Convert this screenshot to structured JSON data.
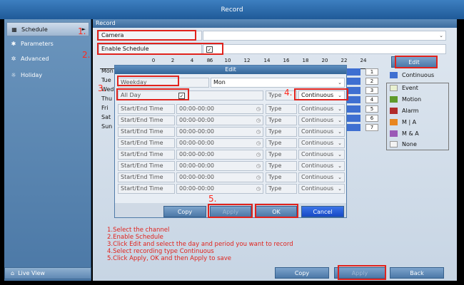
{
  "window": {
    "title": "Record"
  },
  "sidebar": {
    "items": [
      {
        "label": "Schedule",
        "icon": "calendar-icon",
        "active": true
      },
      {
        "label": "Parameters",
        "icon": "gear-icon"
      },
      {
        "label": "Advanced",
        "icon": "settings-icon"
      },
      {
        "label": "Holiday",
        "icon": "holiday-icon"
      }
    ],
    "live_view": "Live View"
  },
  "main": {
    "section_title": "Record",
    "camera_label": "Camera",
    "enable_schedule_label": "Enable Schedule",
    "enable_schedule_checked": "✓",
    "timeline_ticks": [
      "0",
      "2",
      "4",
      "6",
      "8",
      "10",
      "12",
      "14",
      "16",
      "18",
      "20",
      "22",
      "24"
    ],
    "days": [
      {
        "label": "Mon",
        "num": "1"
      },
      {
        "label": "Tue",
        "num": "2"
      },
      {
        "label": "Wed",
        "num": "3"
      },
      {
        "label": "Thu",
        "num": "4"
      },
      {
        "label": "Fri",
        "num": "5"
      },
      {
        "label": "Sat",
        "num": "6"
      },
      {
        "label": "Sun",
        "num": "7"
      }
    ],
    "edit_button": "Edit",
    "continuous_label": "Continuous",
    "legend": [
      {
        "label": "Event",
        "color": "#e8f0d0"
      },
      {
        "label": "Motion",
        "color": "#5f9a2b"
      },
      {
        "label": "Alarm",
        "color": "#b02a2a"
      },
      {
        "label": "M | A",
        "color": "#e8861f"
      },
      {
        "label": "M & A",
        "color": "#9b59b6"
      },
      {
        "label": "None",
        "color": "#f3f3f3"
      }
    ],
    "copy_button": "Copy",
    "apply_button": "Apply",
    "back_button": "Back"
  },
  "dialog": {
    "title": "Edit",
    "weekday_label": "Weekday",
    "weekday_value": "Mon",
    "all_day_label": "All Day",
    "all_day_checked": "✓",
    "type_label": "Type",
    "type_value": "Continuous",
    "rows": [
      {
        "label": "Start/End Time",
        "time": "00:00-00:00",
        "type": "Type",
        "type_value": "Continuous"
      },
      {
        "label": "Start/End Time",
        "time": "00:00-00:00",
        "type": "Type",
        "type_value": "Continuous"
      },
      {
        "label": "Start/End Time",
        "time": "00:00-00:00",
        "type": "Type",
        "type_value": "Continuous"
      },
      {
        "label": "Start/End Time",
        "time": "00:00-00:00",
        "type": "Type",
        "type_value": "Continuous"
      },
      {
        "label": "Start/End Time",
        "time": "00:00-00:00",
        "type": "Type",
        "type_value": "Continuous"
      },
      {
        "label": "Start/End Time",
        "time": "00:00-00:00",
        "type": "Type",
        "type_value": "Continuous"
      },
      {
        "label": "Start/End Time",
        "time": "00:00-00:00",
        "type": "Type",
        "type_value": "Continuous"
      },
      {
        "label": "Start/End Time",
        "time": "00:00-00:00",
        "type": "Type",
        "type_value": "Continuous"
      }
    ],
    "copy_button": "Copy",
    "apply_button": "Apply",
    "ok_button": "OK",
    "cancel_button": "Cancel"
  },
  "annotations": {
    "numbers": [
      "1.",
      "2.",
      "3.",
      "4.",
      "5."
    ],
    "instructions": [
      "1.Select the channel",
      "2.Enable Schedule",
      "3.Click Edit and select the day and period you want to record",
      "4.Select recording type Continuous",
      "5.Click Apply, OK and then Apply to save"
    ],
    "highlight_color": "#e0231d"
  }
}
